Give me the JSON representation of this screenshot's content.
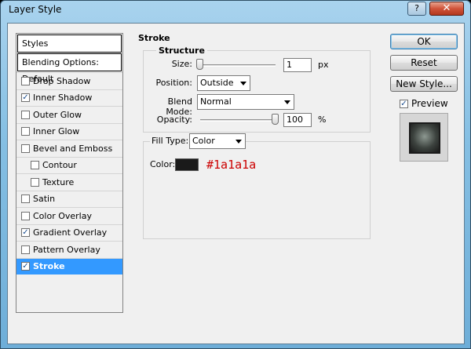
{
  "window": {
    "title": "Layer Style",
    "close_glyph": "✕",
    "help_glyph": "?"
  },
  "styles_panel": {
    "header": "Styles",
    "blending": "Blending Options: Default",
    "items": [
      {
        "label": "Drop Shadow",
        "checked": false,
        "indent": false,
        "selected": false
      },
      {
        "label": "Inner Shadow",
        "checked": true,
        "indent": false,
        "selected": false
      },
      {
        "label": "Outer Glow",
        "checked": false,
        "indent": false,
        "selected": false
      },
      {
        "label": "Inner Glow",
        "checked": false,
        "indent": false,
        "selected": false
      },
      {
        "label": "Bevel and Emboss",
        "checked": false,
        "indent": false,
        "selected": false
      },
      {
        "label": "Contour",
        "checked": false,
        "indent": true,
        "selected": false
      },
      {
        "label": "Texture",
        "checked": false,
        "indent": true,
        "selected": false
      },
      {
        "label": "Satin",
        "checked": false,
        "indent": false,
        "selected": false
      },
      {
        "label": "Color Overlay",
        "checked": false,
        "indent": false,
        "selected": false
      },
      {
        "label": "Gradient Overlay",
        "checked": true,
        "indent": false,
        "selected": false
      },
      {
        "label": "Pattern Overlay",
        "checked": false,
        "indent": false,
        "selected": false
      },
      {
        "label": "Stroke",
        "checked": true,
        "indent": false,
        "selected": true
      }
    ]
  },
  "stroke": {
    "title": "Stroke",
    "structure_title": "Structure",
    "size_label": "Size:",
    "size_value": "1",
    "size_unit": "px",
    "position_label": "Position:",
    "position_value": "Outside",
    "blend_label": "Blend Mode:",
    "blend_value": "Normal",
    "opacity_label": "Opacity:",
    "opacity_value": "100",
    "opacity_unit": "%",
    "fill_type_label": "Fill Type:",
    "fill_type_value": "Color",
    "color_label": "Color:",
    "color_hex": "#1a1a1a",
    "color_note": "#1a1a1a"
  },
  "buttons": {
    "ok": "OK",
    "reset": "Reset",
    "new_style": "New Style...",
    "preview_label": "Preview",
    "preview_checked": true
  }
}
